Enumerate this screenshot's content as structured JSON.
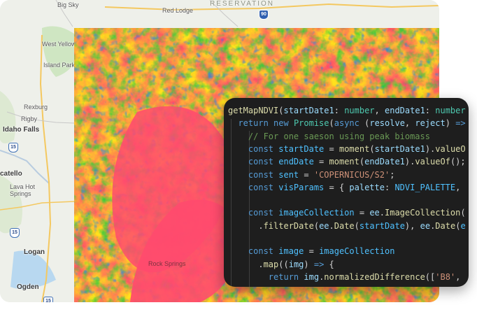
{
  "map": {
    "places": [
      {
        "id": "big-sky",
        "label": "Big Sky"
      },
      {
        "id": "red-lodge",
        "label": "Red Lodge"
      },
      {
        "id": "reservation",
        "label": "RESERVATION"
      },
      {
        "id": "west-yellowstone",
        "label": "West Yellowstone"
      },
      {
        "id": "island-park",
        "label": "Island Park"
      },
      {
        "id": "rexburg",
        "label": "Rexburg"
      },
      {
        "id": "rigby",
        "label": "Rigby"
      },
      {
        "id": "idaho-falls",
        "label": "Idaho Falls"
      },
      {
        "id": "pocatello",
        "label": "catello"
      },
      {
        "id": "lava-hot-springs",
        "label": "Lava Hot\nSprings"
      },
      {
        "id": "logan",
        "label": "Logan"
      },
      {
        "id": "ogden",
        "label": "Ogden"
      },
      {
        "id": "rock-springs",
        "label": "Rock Springs"
      }
    ],
    "routes": [
      "90",
      "15",
      "15",
      "15"
    ],
    "colors": {
      "ndvi_low": "#ff4a6e",
      "ndvi_mid": "#ffe21a",
      "ndvi_high": "#2ccf3a",
      "ndvi_water": "#1e88e5",
      "land": "#eef0ea",
      "park": "#cfe6c2"
    }
  },
  "code": {
    "lines": [
      [
        {
          "t": "getMapNDVI",
          "c": "fn"
        },
        {
          "t": "(",
          "c": "pu"
        },
        {
          "t": "startDate1",
          "c": "va"
        },
        {
          "t": ": ",
          "c": "pu"
        },
        {
          "t": "number",
          "c": "ty"
        },
        {
          "t": ", ",
          "c": "pu"
        },
        {
          "t": "endDate1",
          "c": "va"
        },
        {
          "t": ": ",
          "c": "pu"
        },
        {
          "t": "number",
          "c": "ty"
        }
      ],
      [
        {
          "t": "  return ",
          "c": "kw"
        },
        {
          "t": "new ",
          "c": "kw"
        },
        {
          "t": "Promise",
          "c": "ty"
        },
        {
          "t": "(",
          "c": "pu"
        },
        {
          "t": "async ",
          "c": "kw"
        },
        {
          "t": "(",
          "c": "pu"
        },
        {
          "t": "resolve",
          "c": "va"
        },
        {
          "t": ", ",
          "c": "pu"
        },
        {
          "t": "reject",
          "c": "va"
        },
        {
          "t": ") ",
          "c": "pu"
        },
        {
          "t": "=>",
          "c": "kw"
        }
      ],
      [
        {
          "t": "    // For one saeson using peak biomass",
          "c": "cm"
        }
      ],
      [
        {
          "t": "    const ",
          "c": "kw"
        },
        {
          "t": "startDate",
          "c": "cst"
        },
        {
          "t": " = ",
          "c": "pu"
        },
        {
          "t": "moment",
          "c": "fn"
        },
        {
          "t": "(",
          "c": "pu"
        },
        {
          "t": "startDate1",
          "c": "va"
        },
        {
          "t": ").",
          "c": "pu"
        },
        {
          "t": "valueO",
          "c": "fn"
        }
      ],
      [
        {
          "t": "    const ",
          "c": "kw"
        },
        {
          "t": "endDate",
          "c": "cst"
        },
        {
          "t": " = ",
          "c": "pu"
        },
        {
          "t": "moment",
          "c": "fn"
        },
        {
          "t": "(",
          "c": "pu"
        },
        {
          "t": "endDate1",
          "c": "va"
        },
        {
          "t": ").",
          "c": "pu"
        },
        {
          "t": "valueOf",
          "c": "fn"
        },
        {
          "t": "();",
          "c": "pu"
        }
      ],
      [
        {
          "t": "    const ",
          "c": "kw"
        },
        {
          "t": "sent",
          "c": "cst"
        },
        {
          "t": " = ",
          "c": "pu"
        },
        {
          "t": "'COPERNICUS/S2'",
          "c": "str"
        },
        {
          "t": ";",
          "c": "pu"
        }
      ],
      [
        {
          "t": "    const ",
          "c": "kw"
        },
        {
          "t": "visParams",
          "c": "cst"
        },
        {
          "t": " = { ",
          "c": "pu"
        },
        {
          "t": "palette",
          "c": "va"
        },
        {
          "t": ": ",
          "c": "pu"
        },
        {
          "t": "NDVI_PALETTE",
          "c": "cst"
        },
        {
          "t": ",",
          "c": "pu"
        }
      ],
      [
        {
          "t": "",
          "c": "pu"
        }
      ],
      [
        {
          "t": "    const ",
          "c": "kw"
        },
        {
          "t": "imageCollection",
          "c": "cst"
        },
        {
          "t": " = ",
          "c": "pu"
        },
        {
          "t": "ee",
          "c": "va"
        },
        {
          "t": ".",
          "c": "pu"
        },
        {
          "t": "ImageCollection",
          "c": "fn"
        },
        {
          "t": "(",
          "c": "pu"
        }
      ],
      [
        {
          "t": "      .",
          "c": "pu"
        },
        {
          "t": "filterDate",
          "c": "fn"
        },
        {
          "t": "(",
          "c": "pu"
        },
        {
          "t": "ee",
          "c": "va"
        },
        {
          "t": ".",
          "c": "pu"
        },
        {
          "t": "Date",
          "c": "fn"
        },
        {
          "t": "(",
          "c": "pu"
        },
        {
          "t": "startDate",
          "c": "cst"
        },
        {
          "t": "), ",
          "c": "pu"
        },
        {
          "t": "ee",
          "c": "va"
        },
        {
          "t": ".",
          "c": "pu"
        },
        {
          "t": "Date",
          "c": "fn"
        },
        {
          "t": "(",
          "c": "pu"
        },
        {
          "t": "e",
          "c": "cst"
        }
      ],
      [
        {
          "t": "",
          "c": "pu"
        }
      ],
      [
        {
          "t": "    const ",
          "c": "kw"
        },
        {
          "t": "image",
          "c": "cst"
        },
        {
          "t": " = ",
          "c": "pu"
        },
        {
          "t": "imageCollection",
          "c": "cst"
        }
      ],
      [
        {
          "t": "      .",
          "c": "pu"
        },
        {
          "t": "map",
          "c": "fn"
        },
        {
          "t": "((",
          "c": "pu"
        },
        {
          "t": "img",
          "c": "va"
        },
        {
          "t": ") ",
          "c": "pu"
        },
        {
          "t": "=>",
          "c": "kw"
        },
        {
          "t": " {",
          "c": "pu"
        }
      ],
      [
        {
          "t": "        return ",
          "c": "kw"
        },
        {
          "t": "img",
          "c": "va"
        },
        {
          "t": ".",
          "c": "pu"
        },
        {
          "t": "normalizedDifference",
          "c": "fn"
        },
        {
          "t": "([",
          "c": "pu"
        },
        {
          "t": "'B8'",
          "c": "str"
        },
        {
          "t": ",",
          "c": "pu"
        }
      ]
    ]
  }
}
